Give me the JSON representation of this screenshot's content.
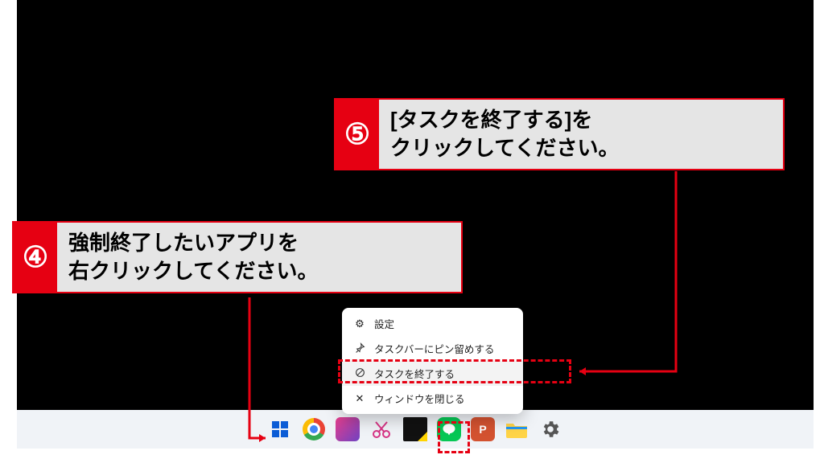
{
  "callouts": {
    "four": {
      "badge": "④",
      "text": "強制終了したいアプリを\n右クリックしてください。"
    },
    "five": {
      "badge": "⑤",
      "text": "[タスクを終了する]を\nクリックしてください。"
    }
  },
  "context_menu": {
    "items": [
      {
        "icon": "⚙",
        "label": "設定"
      },
      {
        "icon": "📌",
        "label": "タスクバーにピン留めする"
      },
      {
        "icon": "⊘",
        "label": "タスクを終了する"
      },
      {
        "icon": "✕",
        "label": "ウィンドウを閉じる"
      }
    ]
  },
  "colors": {
    "accent": "#e60012"
  }
}
